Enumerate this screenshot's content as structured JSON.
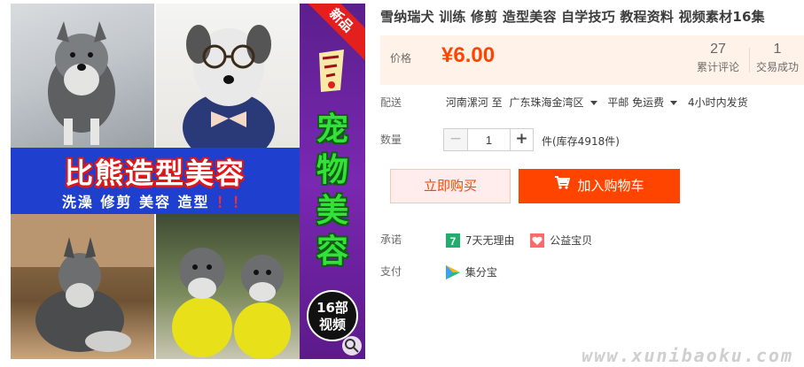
{
  "gallery": {
    "banner_title": "比熊造型美容",
    "banner_sub": "洗澡 修剪 美容 造型",
    "banner_sub_bang": "！！",
    "side_text": "宠物美容",
    "badge_line1": "16部",
    "badge_line2": "视频",
    "corner_tag": "新品"
  },
  "product": {
    "title": "雪纳瑞犬 训练 修剪 造型美容 自学技巧 教程资料 视频素材16集"
  },
  "price": {
    "label": "价格",
    "value": "¥6.00",
    "reviews_count": "27",
    "reviews_label": "累计评论",
    "sales_count": "1",
    "sales_label": "交易成功"
  },
  "shipping": {
    "label": "配送",
    "from": "河南漯河 至",
    "to": "广东珠海金湾区",
    "method": "平邮 免运费",
    "dispatch": "4小时内发货"
  },
  "quantity": {
    "label": "数量",
    "minus": "−",
    "value": "1",
    "plus": "+",
    "stock": "件(库存4918件)"
  },
  "actions": {
    "buy_now": "立即购买",
    "add_to_cart": "加入购物车"
  },
  "promise": {
    "label": "承诺",
    "items": [
      "7天无理由",
      "公益宝贝"
    ]
  },
  "payment": {
    "label": "支付",
    "method": "集分宝"
  },
  "watermark": "www.xunibaoku.com",
  "colors": {
    "accent": "#ff4400",
    "price": "#ff4400",
    "price_bg": "#fff2e8",
    "banner_blue": "#1f3fcf",
    "side_purple": "#6a22a0",
    "side_green": "#34e03a"
  }
}
